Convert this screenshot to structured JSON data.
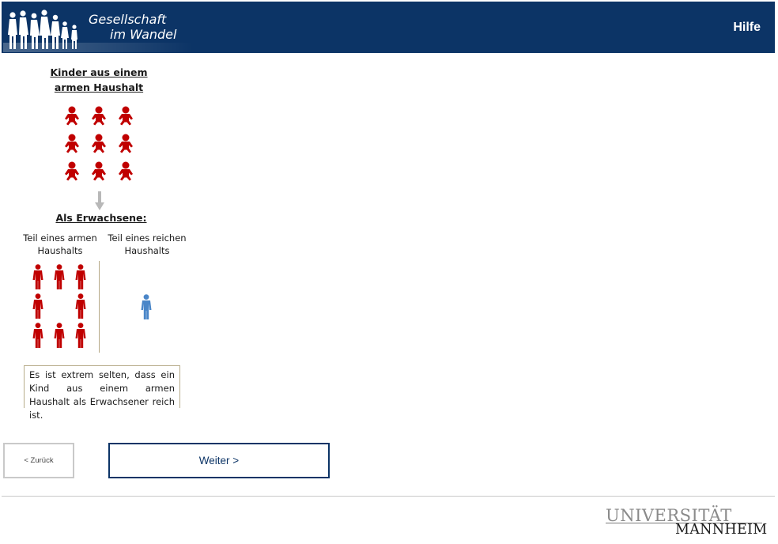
{
  "header": {
    "logo_line1": "Gesellschaft",
    "logo_line2": "im Wandel",
    "help_label": "Hilfe"
  },
  "infographic": {
    "kids_heading_line1": "Kinder aus einem",
    "kids_heading_line2": "armen Haushalt",
    "adults_heading": "Als Erwachsene:",
    "poor_label_line1": "Teil eines armen",
    "poor_label_line2": "Haushalts",
    "rich_label_line1": "Teil eines reichen",
    "rich_label_line2": "Haushalts",
    "note": "Es ist extrem selten, dass ein Kind aus einem armen Haushalt als Erwachsener reich ist.",
    "kids_count": 9,
    "poor_adults_count": 8,
    "rich_adults_count": 1,
    "poor_color": "#c00000",
    "rich_color": "#4a86c8"
  },
  "navigation": {
    "back_label": "< Zurück",
    "next_label": "Weiter >"
  },
  "footer": {
    "uni_line1": "UNIVERSITÄT",
    "uni_line2": "MANNHEIM"
  },
  "colors": {
    "header_bg": "#0c3466",
    "accent": "#0c3466"
  }
}
